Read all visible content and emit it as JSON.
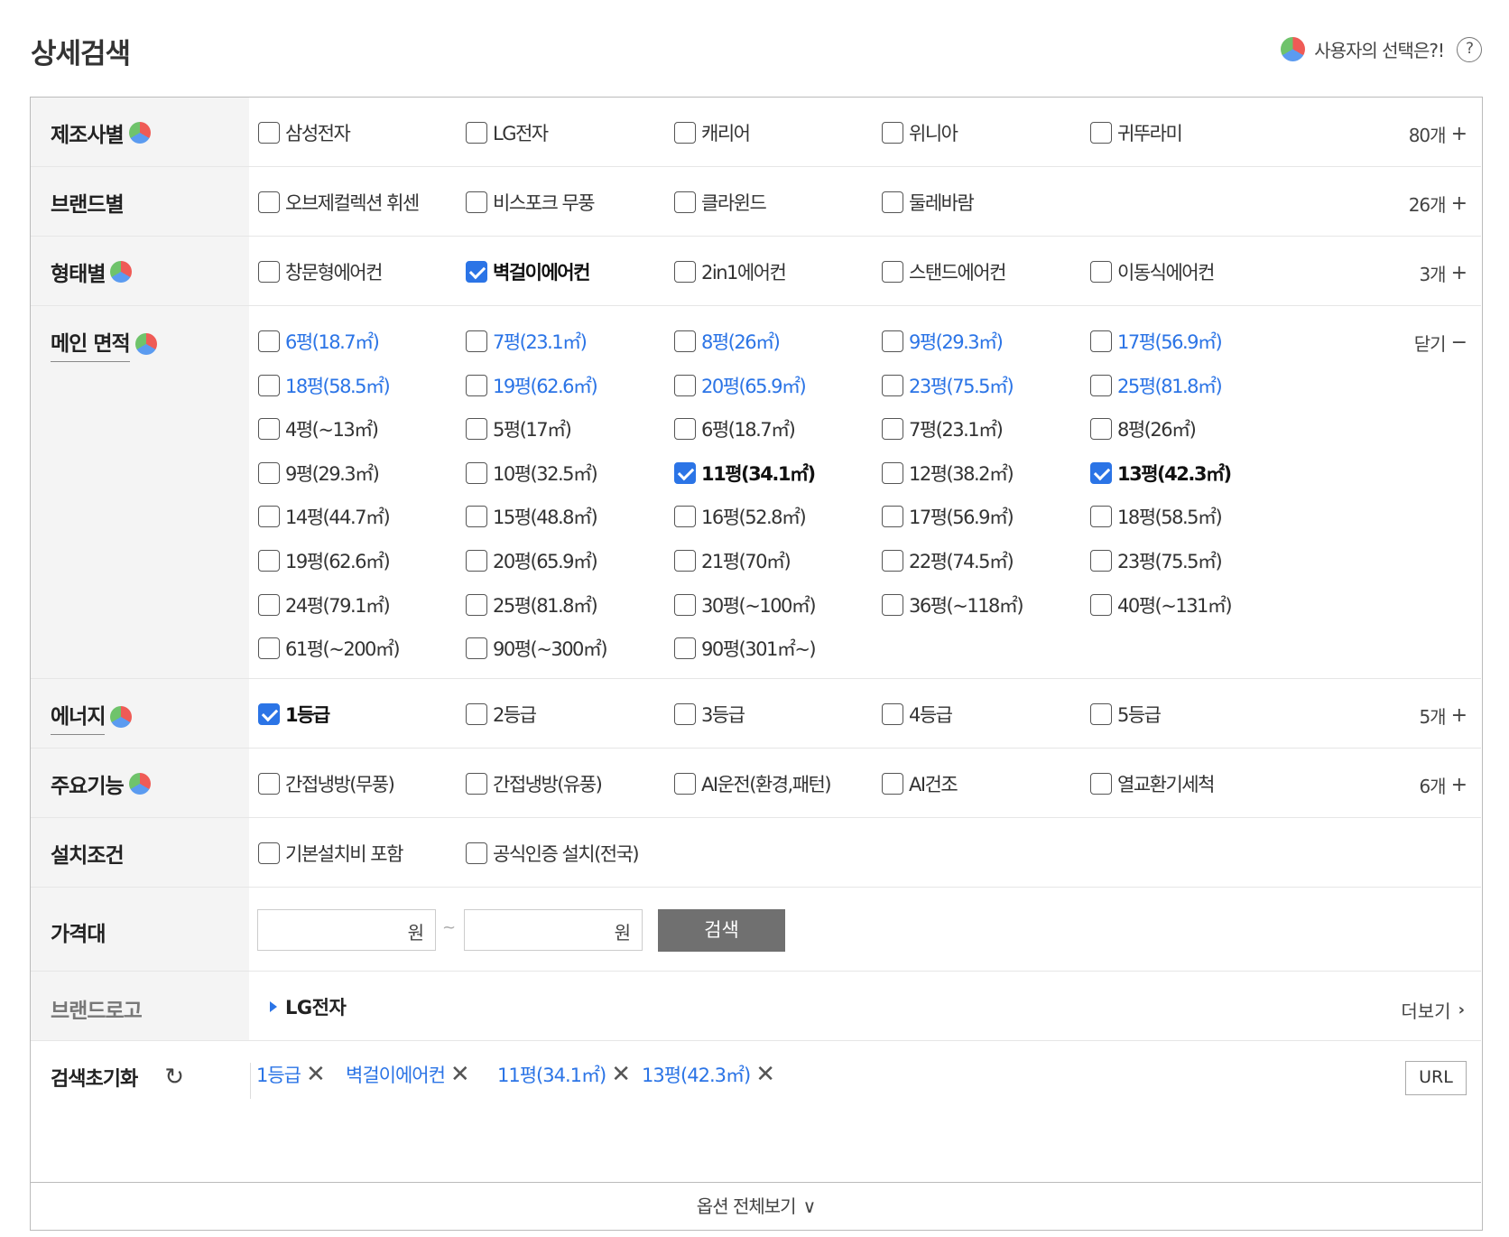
{
  "header": {
    "title": "상세검색",
    "user_choice_label": "사용자의 선택은?!",
    "help_symbol": "?"
  },
  "rows": {
    "maker": {
      "label": "제조사별",
      "options": [
        {
          "label": "삼성전자",
          "checked": false
        },
        {
          "label": "LG전자",
          "checked": false
        },
        {
          "label": "캐리어",
          "checked": false
        },
        {
          "label": "위니아",
          "checked": false
        },
        {
          "label": "귀뚜라미",
          "checked": false
        }
      ],
      "count": "80개",
      "count_symbol": "+"
    },
    "brand": {
      "label": "브랜드별",
      "options": [
        {
          "label": "오브제컬렉션 휘센",
          "checked": false
        },
        {
          "label": "비스포크 무풍",
          "checked": false
        },
        {
          "label": "클라윈드",
          "checked": false
        },
        {
          "label": "둘레바람",
          "checked": false
        }
      ],
      "count": "26개",
      "count_symbol": "+"
    },
    "type": {
      "label": "형태별",
      "options": [
        {
          "label": "창문형에어컨",
          "checked": false
        },
        {
          "label": "벽걸이에어컨",
          "checked": true
        },
        {
          "label": "2in1에어컨",
          "checked": false
        },
        {
          "label": "스탠드에어컨",
          "checked": false
        },
        {
          "label": "이동식에어컨",
          "checked": false
        }
      ],
      "count": "3개",
      "count_symbol": "+"
    },
    "area": {
      "label": "메인 면적",
      "toggle": "닫기",
      "toggle_symbol": "−",
      "options": [
        {
          "label": "6평(18.7㎡)",
          "checked": false,
          "highlight": true
        },
        {
          "label": "7평(23.1㎡)",
          "checked": false,
          "highlight": true
        },
        {
          "label": "8평(26㎡)",
          "checked": false,
          "highlight": true
        },
        {
          "label": "9평(29.3㎡)",
          "checked": false,
          "highlight": true
        },
        {
          "label": "17평(56.9㎡)",
          "checked": false,
          "highlight": true
        },
        {
          "label": "18평(58.5㎡)",
          "checked": false,
          "highlight": true
        },
        {
          "label": "19평(62.6㎡)",
          "checked": false,
          "highlight": true
        },
        {
          "label": "20평(65.9㎡)",
          "checked": false,
          "highlight": true
        },
        {
          "label": "23평(75.5㎡)",
          "checked": false,
          "highlight": true
        },
        {
          "label": "25평(81.8㎡)",
          "checked": false,
          "highlight": true
        },
        {
          "label": "4평(~13㎡)",
          "checked": false,
          "highlight": false
        },
        {
          "label": "5평(17㎡)",
          "checked": false,
          "highlight": false
        },
        {
          "label": "6평(18.7㎡)",
          "checked": false,
          "highlight": false
        },
        {
          "label": "7평(23.1㎡)",
          "checked": false,
          "highlight": false
        },
        {
          "label": "8평(26㎡)",
          "checked": false,
          "highlight": false
        },
        {
          "label": "9평(29.3㎡)",
          "checked": false,
          "highlight": false
        },
        {
          "label": "10평(32.5㎡)",
          "checked": false,
          "highlight": false
        },
        {
          "label": "11평(34.1㎡)",
          "checked": true,
          "highlight": false
        },
        {
          "label": "12평(38.2㎡)",
          "checked": false,
          "highlight": false
        },
        {
          "label": "13평(42.3㎡)",
          "checked": true,
          "highlight": false
        },
        {
          "label": "14평(44.7㎡)",
          "checked": false,
          "highlight": false
        },
        {
          "label": "15평(48.8㎡)",
          "checked": false,
          "highlight": false
        },
        {
          "label": "16평(52.8㎡)",
          "checked": false,
          "highlight": false
        },
        {
          "label": "17평(56.9㎡)",
          "checked": false,
          "highlight": false
        },
        {
          "label": "18평(58.5㎡)",
          "checked": false,
          "highlight": false
        },
        {
          "label": "19평(62.6㎡)",
          "checked": false,
          "highlight": false
        },
        {
          "label": "20평(65.9㎡)",
          "checked": false,
          "highlight": false
        },
        {
          "label": "21평(70㎡)",
          "checked": false,
          "highlight": false
        },
        {
          "label": "22평(74.5㎡)",
          "checked": false,
          "highlight": false
        },
        {
          "label": "23평(75.5㎡)",
          "checked": false,
          "highlight": false
        },
        {
          "label": "24평(79.1㎡)",
          "checked": false,
          "highlight": false
        },
        {
          "label": "25평(81.8㎡)",
          "checked": false,
          "highlight": false
        },
        {
          "label": "30평(~100㎡)",
          "checked": false,
          "highlight": false
        },
        {
          "label": "36평(~118㎡)",
          "checked": false,
          "highlight": false
        },
        {
          "label": "40평(~131㎡)",
          "checked": false,
          "highlight": false
        },
        {
          "label": "61평(~200㎡)",
          "checked": false,
          "highlight": false
        },
        {
          "label": "90평(~300㎡)",
          "checked": false,
          "highlight": false
        },
        {
          "label": "90평(301㎡~)",
          "checked": false,
          "highlight": false
        }
      ]
    },
    "energy": {
      "label": "에너지",
      "options": [
        {
          "label": "1등급",
          "checked": true
        },
        {
          "label": "2등급",
          "checked": false
        },
        {
          "label": "3등급",
          "checked": false
        },
        {
          "label": "4등급",
          "checked": false
        },
        {
          "label": "5등급",
          "checked": false
        }
      ],
      "count": "5개",
      "count_symbol": "+"
    },
    "feature": {
      "label": "주요기능",
      "options": [
        {
          "label": "간접냉방(무풍)",
          "checked": false
        },
        {
          "label": "간접냉방(유풍)",
          "checked": false
        },
        {
          "label": "AI운전(환경,패턴)",
          "checked": false
        },
        {
          "label": "AI건조",
          "checked": false
        },
        {
          "label": "열교환기세척",
          "checked": false
        }
      ],
      "count": "6개",
      "count_symbol": "+"
    },
    "install": {
      "label": "설치조건",
      "options": [
        {
          "label": "기본설치비 포함",
          "checked": false
        },
        {
          "label": "공식인증 설치(전국)",
          "checked": false
        }
      ]
    },
    "price": {
      "label": "가격대",
      "min_value": "",
      "max_value": "",
      "unit": "원",
      "separator": "~",
      "search_label": "검색"
    },
    "brandlogo": {
      "label": "브랜드로고",
      "link": "LG전자",
      "more": "더보기",
      "more_symbol": "›"
    },
    "reset": {
      "label": "검색초기화",
      "refresh_symbol": "↻",
      "chips": [
        {
          "label": "1등급"
        },
        {
          "label": "벽걸이에어컨"
        },
        {
          "label": "11평(34.1㎡)"
        },
        {
          "label": "13평(42.3㎡)"
        }
      ],
      "remove_symbol": "✕",
      "url_label": "URL"
    }
  },
  "footer": {
    "all_options": "옵션 전체보기",
    "chevron": "∨"
  },
  "colors": {
    "accent": "#2b74e6",
    "label_bg": "#f4f4f4",
    "button_gray": "#707070"
  }
}
